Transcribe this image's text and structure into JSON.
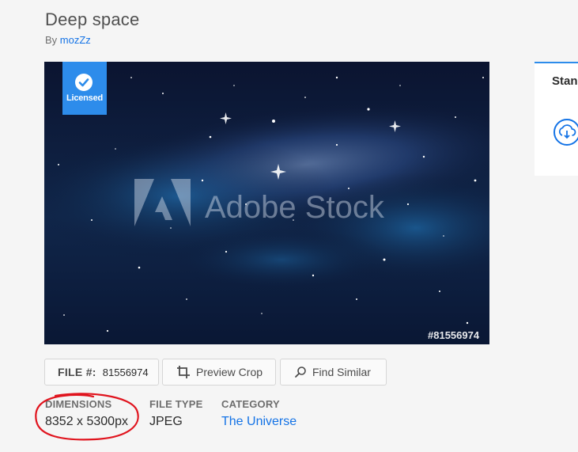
{
  "header": {
    "title": "Deep space",
    "by_prefix": "By",
    "author": "mozZz"
  },
  "preview": {
    "badge_label": "Licensed",
    "watermark": "Adobe Stock",
    "file_number_overlay": "#81556974"
  },
  "license_panel": {
    "title": "Stan",
    "icon": "cloud-download-icon",
    "accent": "#2d8ceb"
  },
  "actions": {
    "file_key": "FILE #:",
    "file_value": "81556974",
    "preview_crop": "Preview Crop",
    "find_similar": "Find Similar"
  },
  "details": {
    "dimensions_label": "DIMENSIONS",
    "dimensions_value": "8352 x 5300px",
    "file_type_label": "FILE TYPE",
    "file_type_value": "JPEG",
    "category_label": "CATEGORY",
    "category_value": "The Universe"
  },
  "colors": {
    "link": "#1473e6",
    "annotation": "#e0141e"
  }
}
